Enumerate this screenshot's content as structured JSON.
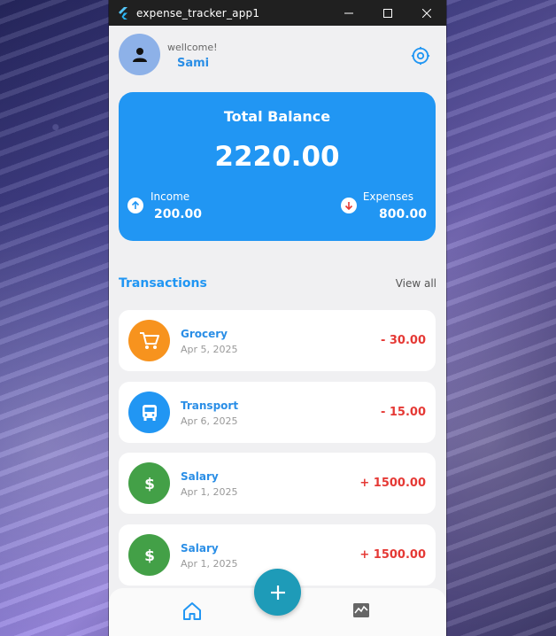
{
  "window": {
    "title": "expense_tracker_app1"
  },
  "header": {
    "greeting": "wellcome!",
    "username": "Sami"
  },
  "balance": {
    "title": "Total Balance",
    "amount": "2220.00",
    "income_label": "Income",
    "income_value": "200.00",
    "expenses_label": "Expenses",
    "expenses_value": "800.00"
  },
  "transactions": {
    "title": "Transactions",
    "view_all": "View all",
    "items": [
      {
        "name": "Grocery",
        "date": "Apr 5, 2025",
        "amount": "- 30.00",
        "icon": "cart-icon",
        "color": "#f7931e"
      },
      {
        "name": "Transport",
        "date": "Apr 6, 2025",
        "amount": "- 15.00",
        "icon": "bus-icon",
        "color": "#2196f3"
      },
      {
        "name": "Salary",
        "date": "Apr 1, 2025",
        "amount": "+ 1500.00",
        "icon": "dollar-icon",
        "color": "#43a047"
      },
      {
        "name": "Salary",
        "date": "Apr 1, 2025",
        "amount": "+ 1500.00",
        "icon": "dollar-icon",
        "color": "#43a047"
      }
    ]
  },
  "colors": {
    "accent": "#2196f3",
    "expense": "#e53935",
    "fab": "#1e9bb8"
  }
}
